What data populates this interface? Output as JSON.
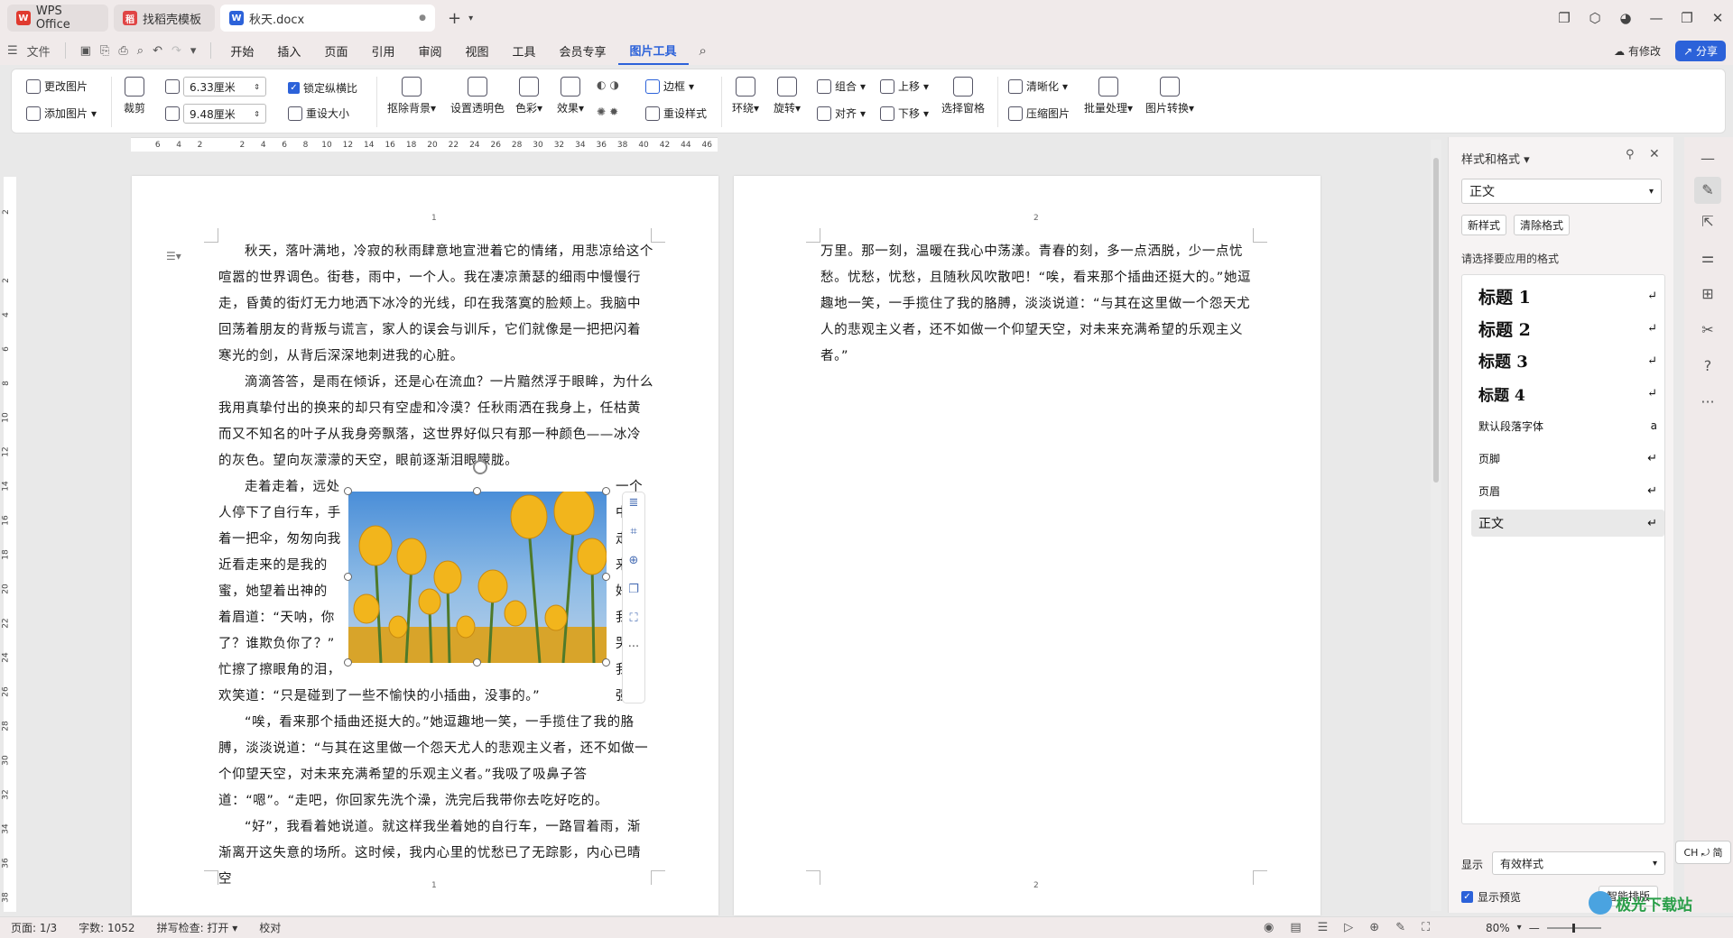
{
  "titlebar": {
    "tabs": [
      {
        "label": "WPS Office"
      },
      {
        "label": "找稻壳模板"
      },
      {
        "label": "秋天.docx"
      }
    ],
    "new_tab": "+"
  },
  "menubar": {
    "file": "文件",
    "items": [
      "开始",
      "插入",
      "页面",
      "引用",
      "审阅",
      "视图",
      "工具",
      "会员专享",
      "图片工具"
    ],
    "active": "图片工具",
    "modified": "有修改",
    "share": "分享"
  },
  "ribbon": {
    "change_pic": "更改图片",
    "add_pic": "添加图片",
    "crop": "裁剪",
    "width_value": "6.33厘米",
    "height_value": "9.48厘米",
    "lock_ratio": "锁定纵横比",
    "reset_size": "重设大小",
    "remove_bg": "抠除背景",
    "set_transparent": "设置透明色",
    "color": "色彩",
    "effects": "效果",
    "border": "边框",
    "reset_style": "重设样式",
    "wrap": "环绕",
    "rotate": "旋转",
    "group": "组合",
    "align": "对齐",
    "move_up": "上移",
    "move_down": "下移",
    "selection_pane": "选择窗格",
    "sharpen": "清晰化",
    "compress": "压缩图片",
    "batch": "批量处理",
    "convert": "图片转换"
  },
  "ruler": {
    "ticks": [
      "6",
      "4",
      "2",
      "",
      "2",
      "4",
      "6",
      "8",
      "10",
      "12",
      "14",
      "16",
      "18",
      "20",
      "22",
      "24",
      "26",
      "28",
      "30",
      "32",
      "34",
      "36",
      "38",
      "40",
      "42",
      "44",
      "46"
    ],
    "vticks": [
      "2",
      "",
      "2",
      "4",
      "6",
      "8",
      "10",
      "12",
      "14",
      "16",
      "18",
      "20",
      "22",
      "24",
      "26",
      "28",
      "30",
      "32",
      "34",
      "36",
      "38"
    ]
  },
  "page1": {
    "page_number": "1",
    "p1": "秋天，落叶满地，冷寂的秋雨肆意地宣泄着它的情绪，用悲凉给这个喧嚣的世界调色。街巷，雨中，一个人。我在凄凉萧瑟的细雨中慢慢行走，昏黄的街灯无力地洒下冰冷的光线，印在我落寞的脸颊上。我脑中回荡着朋友的背叛与谎言，家人的误会与训斥，它们就像是一把把闪着寒光的剑，从背后深深地刺进我的心脏。",
    "p2": "滴滴答答，是雨在倾诉，还是心在流血？一片黯然浮于眼眸，为什么我用真挚付出的换来的却只有空虚和冷漠？任秋雨洒在我身上，任枯黄而又不知名的叶子从我身旁飘落，这世界好似只有那一种颜色——冰冷的灰色。望向灰濛濛的天空，眼前逐渐泪眼朦胧。",
    "p3_lines": [
      "走着走着，远处",
      "人停下了自行车，手",
      "着一把伞，匆匆向我",
      "近看走来的是我的",
      "蜜，她望着出神的",
      "着眉道：“天呐，你",
      "了？谁欺负你了？”",
      "忙擦了擦眼角的泪，"
    ],
    "p3_right": [
      "一个",
      "中拿",
      "走来。",
      "好",
      "我皱",
      "哭",
      "我连",
      "强颜"
    ],
    "p3_end": "欢笑道：“只是碰到了一些不愉快的小插曲，没事的。”",
    "p4": "“唉，看来那个插曲还挺大的。”她逗趣地一笑，一手揽住了我的胳膊，淡淡说道：“与其在这里做一个怨天尤人的悲观主义者，还不如做一个仰望天空，对未来充满希望的乐观主义者。”我吸了吸鼻子答道：“嗯”。“走吧，你回家先洗个澡，洗完后我带你去吃好吃的。",
    "p5": "“好”，我看着她说道。就这样我坐着她的自行车，一路冒着雨，渐渐离开这失意的场所。这时候，我内心里的忧愁已了无踪影，内心已晴空"
  },
  "page2": {
    "page_number": "2",
    "text": "万里。那一刻，温暖在我心中荡漾。青春的刻，多一点洒脱，少一点忧愁。忧愁，忧愁，且随秋风吹散吧！“唉，看来那个插曲还挺大的。”她逗趣地一笑，一手揽住了我的胳膊，淡淡说道：“与其在这里做一个怨天尤人的悲观主义者，还不如做一个仰望天空，对未来充满希望的乐观主义者。”",
    "footer_number": "2"
  },
  "pane": {
    "title": "样式和格式",
    "current_style": "正文",
    "new_style": "新样式",
    "clear_format": "清除格式",
    "prompt": "请选择要应用的格式",
    "styles": [
      {
        "label": "标题  1",
        "mark": "↵"
      },
      {
        "label": "标题  2",
        "mark": "↵"
      },
      {
        "label": "标题  3",
        "mark": "↵"
      },
      {
        "label": "标题 4",
        "mark": "↵"
      },
      {
        "label": "默认段落字体",
        "mark": "a"
      },
      {
        "label": "页脚",
        "mark": "↵"
      },
      {
        "label": "页眉",
        "mark": "↵"
      },
      {
        "label": "正文",
        "mark": "↵"
      }
    ],
    "display_label": "显示",
    "display_value": "有效样式",
    "show_preview": "显示预览",
    "smart_layout": "智能排版"
  },
  "ime": "CH ⤾ 简",
  "watermark": "极光下载站",
  "status": {
    "page": "页面: 1/3",
    "words": "字数: 1052",
    "spell": "拼写检查: 打开",
    "proof": "校对",
    "zoom": "80%"
  }
}
